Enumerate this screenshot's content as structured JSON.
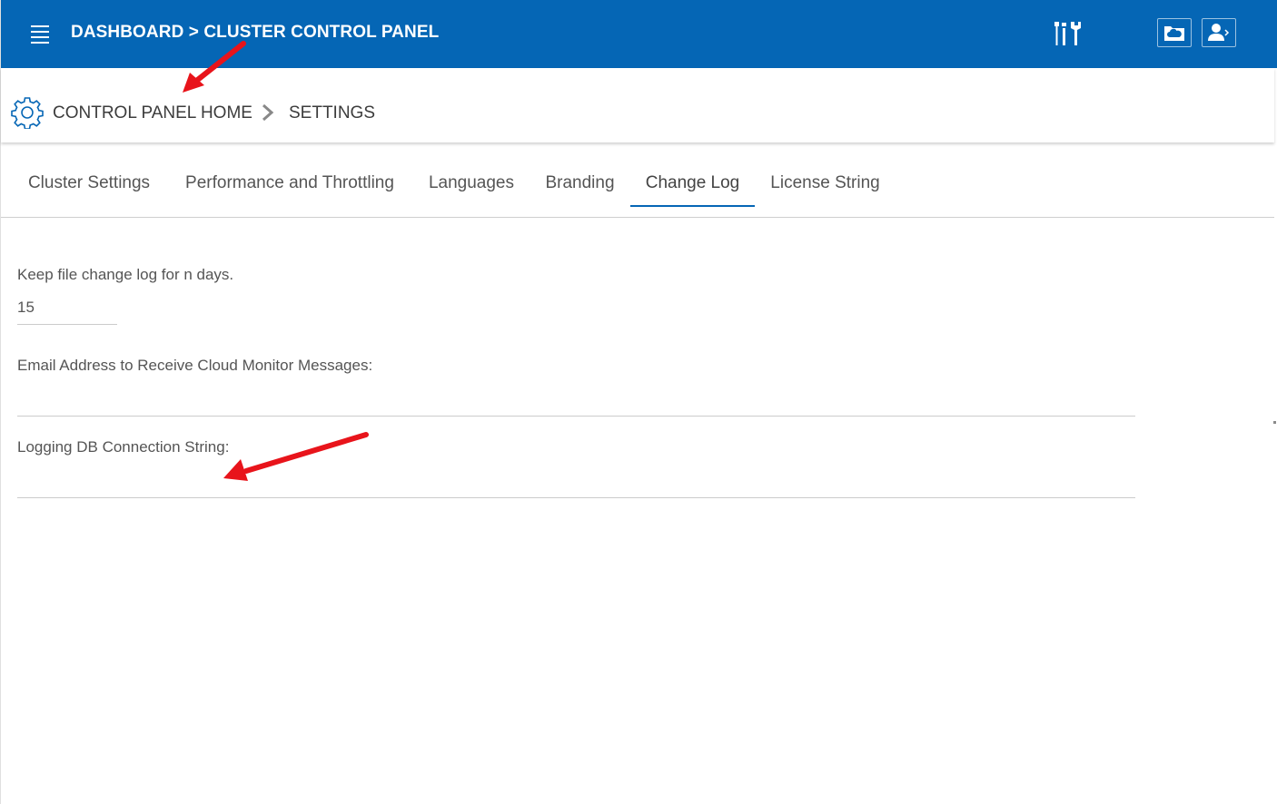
{
  "header": {
    "title": "DASHBOARD > CLUSTER CONTROL PANEL",
    "color": "#0566b5"
  },
  "icons": {
    "menu": "hamburger-icon",
    "tools": "tools-icon",
    "cloud": "cloud-folder-icon",
    "user": "user-icon",
    "breadcrumb_home": "gear-icon",
    "separator": "chevron-right-icon"
  },
  "breadcrumb": {
    "home": "CONTROL PANEL HOME",
    "current": "SETTINGS"
  },
  "tabs": [
    {
      "label": "Cluster Settings",
      "active": false
    },
    {
      "label": "Performance and Throttling",
      "active": false
    },
    {
      "label": "Languages",
      "active": false
    },
    {
      "label": "Branding",
      "active": false
    },
    {
      "label": "Change Log",
      "active": true
    },
    {
      "label": "License String",
      "active": false
    }
  ],
  "form": {
    "keep_log_label": "Keep file change log for n days.",
    "keep_log_value": "15",
    "email_label": "Email Address to Receive Cloud Monitor Messages:",
    "email_value": "",
    "db_label": "Logging DB Connection String:",
    "db_value": ""
  },
  "annotation_color": "#e8141b"
}
